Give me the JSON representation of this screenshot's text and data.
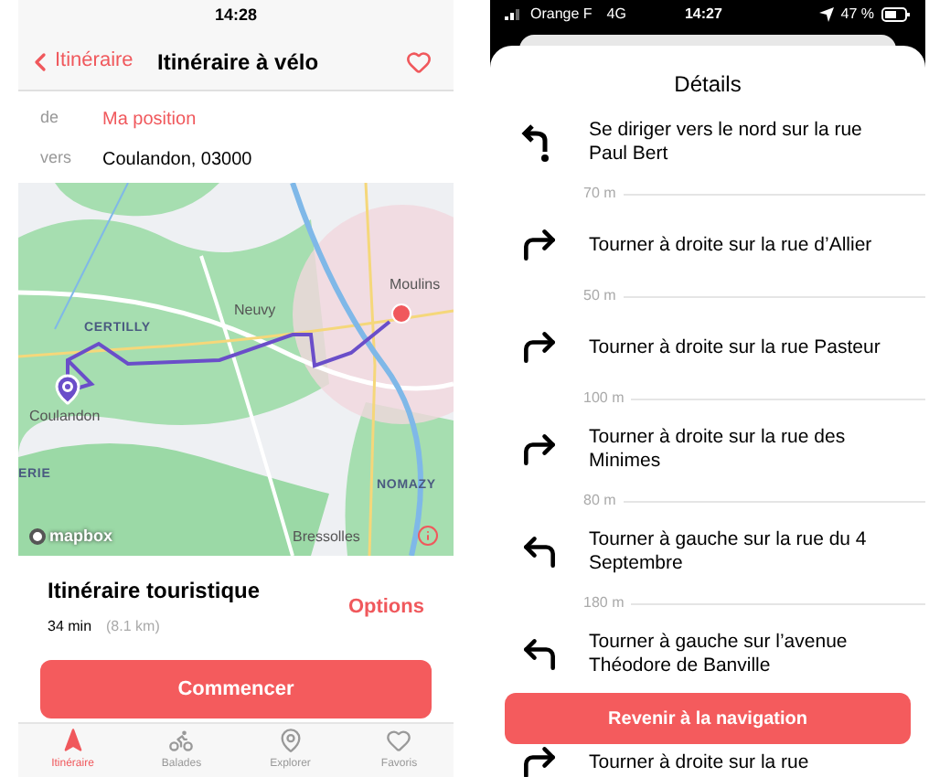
{
  "left_screen": {
    "status_bar": {
      "time": "14:28"
    },
    "nav": {
      "back_label": "Itinéraire",
      "title": "Itinéraire à vélo"
    },
    "route_fields": [
      {
        "label": "de",
        "value": "Ma position",
        "kind": "current"
      },
      {
        "label": "vers",
        "value": "Coulandon, 03000",
        "kind": "address"
      }
    ],
    "map": {
      "labels": [
        {
          "text": "Moulins",
          "kind": "town"
        },
        {
          "text": "Neuvy",
          "kind": "town"
        },
        {
          "text": "CERTILLY",
          "kind": "district"
        },
        {
          "text": "Coulandon",
          "kind": "town"
        },
        {
          "text": "ERIE",
          "kind": "district"
        },
        {
          "text": "NOMAZY",
          "kind": "district"
        },
        {
          "text": "Bressolles",
          "kind": "town"
        }
      ],
      "attribution": "mapbox"
    },
    "summary": {
      "title": "Itinéraire touristique",
      "duration": "34 min",
      "distance": "(8.1 km)",
      "options": "Options"
    },
    "start_button": "Commencer",
    "tabs": [
      {
        "label": "Itinéraire",
        "selected": true
      },
      {
        "label": "Balades",
        "selected": false
      },
      {
        "label": "Explorer",
        "selected": false
      },
      {
        "label": "Favoris",
        "selected": false
      }
    ]
  },
  "right_screen": {
    "status_bar": {
      "carrier": "Orange F",
      "network": "4G",
      "time": "14:27",
      "battery": "47 %"
    },
    "title": "Détails",
    "steps": [
      {
        "instruction": "Se diriger vers le nord sur la rue Paul Bert",
        "kind": "start",
        "distance": "70 m"
      },
      {
        "instruction": "Tourner à droite sur la rue d’Allier",
        "kind": "right",
        "distance": "50 m"
      },
      {
        "instruction": "Tourner à droite sur la rue Pasteur",
        "kind": "right",
        "distance": "100 m"
      },
      {
        "instruction": "Tourner à droite sur la rue des Minimes",
        "kind": "right",
        "distance": "80 m"
      },
      {
        "instruction": "Tourner à gauche sur la rue du 4 Septembre",
        "kind": "left",
        "distance": "180 m"
      },
      {
        "instruction": "Tourner à gauche sur l’avenue Théodore de Banville",
        "kind": "left"
      },
      {
        "instruction": "Tourner à droite sur la rue",
        "kind": "right"
      }
    ],
    "button": "Revenir à la navigation"
  }
}
